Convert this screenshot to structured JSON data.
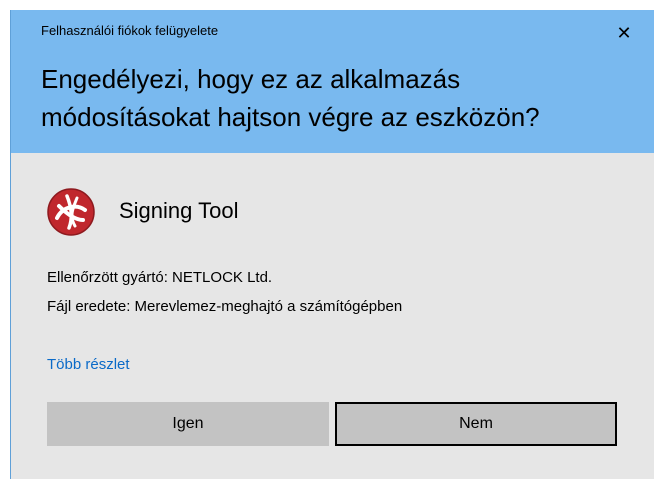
{
  "window": {
    "title": "Felhasználói fiókok felügyelete"
  },
  "question": {
    "line1": "Engedélyezi, hogy ez az alkalmazás",
    "line2": "módosításokat hajtson végre az eszközön?"
  },
  "app": {
    "name": "Signing Tool",
    "icon": "netlock-logo-icon"
  },
  "details": {
    "publisher": "Ellenőrzött gyártó: NETLOCK Ltd.",
    "origin": "Fájl eredete: Merevlemez-meghajtó a számítógépben"
  },
  "more_details_link": "Több részlet",
  "buttons": {
    "yes": "Igen",
    "no": "Nem"
  },
  "colors": {
    "header": "#79b9ef",
    "body": "#e6e6e6",
    "link": "#0a6ac8",
    "button": "#c3c3c3",
    "logo": "#c0272d"
  }
}
